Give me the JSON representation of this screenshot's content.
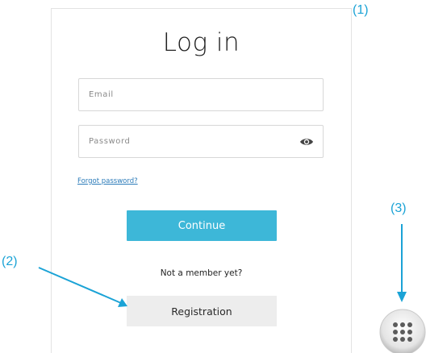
{
  "login": {
    "title": "Log in",
    "email_placeholder": "Email",
    "password_placeholder": "Password",
    "forgot_label": "Forgot password?",
    "continue_label": "Continue",
    "not_member_text": "Not a member yet?",
    "registration_label": "Registration"
  },
  "callouts": {
    "one": "(1)",
    "two": "(2)",
    "three": "(3)"
  },
  "colors": {
    "accent": "#3db7d8",
    "callout": "#1ba3d6",
    "link": "#2b7bb9",
    "secondary_button": "#ededed"
  },
  "icons": {
    "password_toggle": "eye-icon",
    "app_launcher": "grid-icon"
  }
}
